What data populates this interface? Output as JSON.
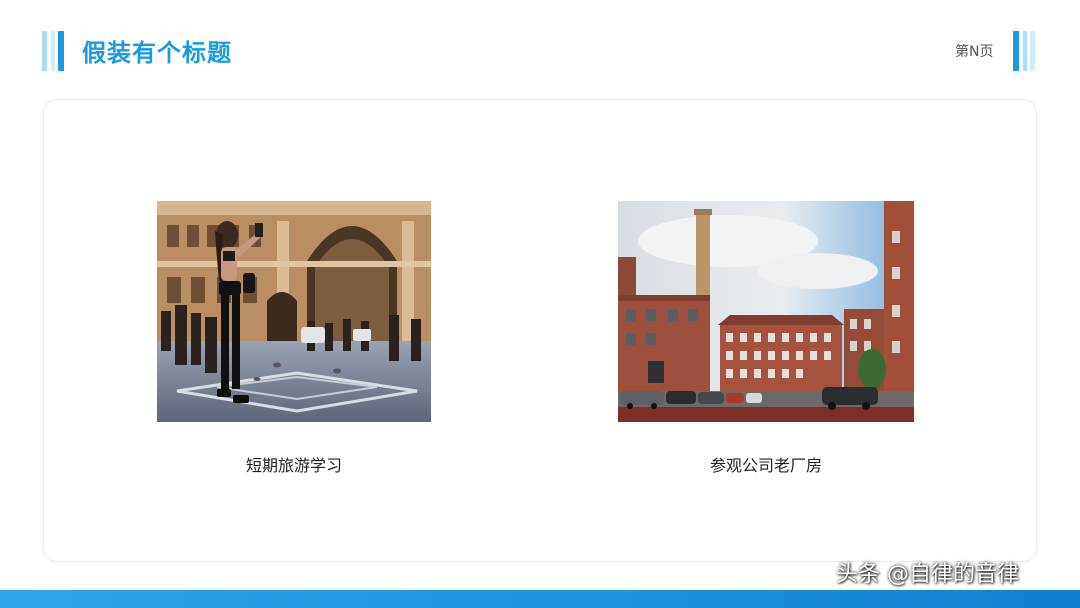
{
  "header": {
    "title": "假装有个标题",
    "page_number": "第N页"
  },
  "items": [
    {
      "caption": "短期旅游学习",
      "image": "street-crowd-photo"
    },
    {
      "caption": "参观公司老厂房",
      "image": "old-brick-factory-photo"
    }
  ],
  "watermark": "头条 @自律的音律",
  "colors": {
    "accent": "#1a9ae0",
    "accent_light": "#a9dcf5",
    "bottom_bar": "#1993dd",
    "card_border": "#ececec"
  }
}
